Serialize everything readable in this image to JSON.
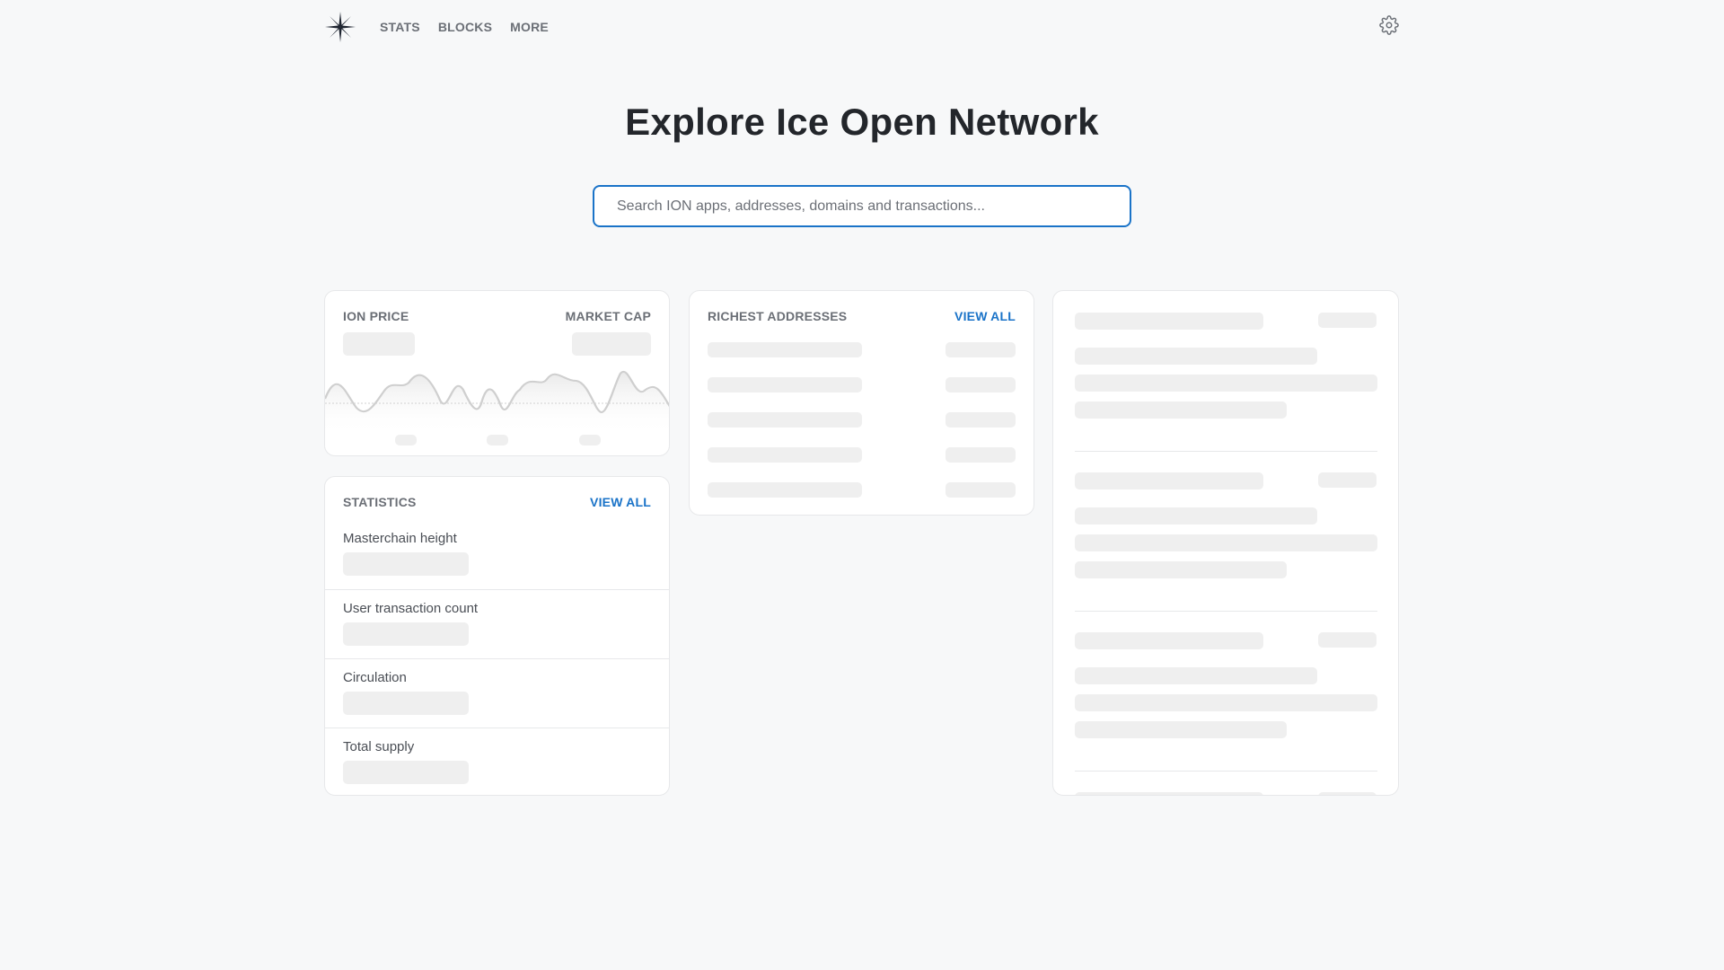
{
  "nav": {
    "items": [
      {
        "label": "STATS"
      },
      {
        "label": "BLOCKS"
      },
      {
        "label": "MORE"
      }
    ]
  },
  "hero": {
    "title": "Explore Ice Open Network"
  },
  "search": {
    "placeholder": "Search ION apps, addresses, domains and transactions..."
  },
  "price_card": {
    "price_label": "ION PRICE",
    "cap_label": "MARKET CAP"
  },
  "richest": {
    "title": "RICHEST ADDRESSES",
    "view_all": "VIEW ALL"
  },
  "statistics": {
    "title": "STATISTICS",
    "view_all": "VIEW ALL",
    "rows": [
      {
        "label": "Masterchain height"
      },
      {
        "label": "User transaction count"
      },
      {
        "label": "Circulation"
      },
      {
        "label": "Total supply"
      }
    ]
  },
  "colors": {
    "accent": "#1a73c8",
    "skeleton": "#efefef",
    "background": "#f7f8f9"
  },
  "icons": {
    "logo": "snowflake-star-icon",
    "settings": "gear-icon"
  }
}
